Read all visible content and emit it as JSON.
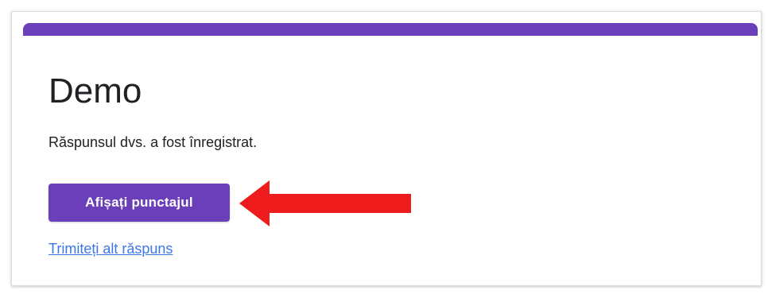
{
  "form": {
    "title": "Demo",
    "confirmation_message": "Răspunsul dvs. a fost înregistrat.",
    "view_score_label": "Afișați punctajul",
    "submit_another_label": "Trimiteți alt răspuns"
  },
  "colors": {
    "accent": "#6a3fb9",
    "link": "#3b78e7",
    "annotation_arrow": "#ee1c1c"
  },
  "annotation": {
    "icon": "arrow-left-icon"
  }
}
